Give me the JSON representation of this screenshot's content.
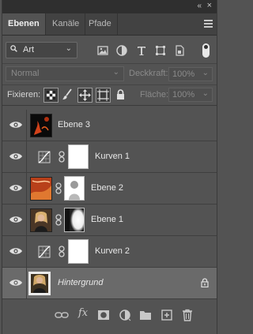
{
  "panel": {
    "tabs": [
      {
        "label": "Ebenen",
        "active": true
      },
      {
        "label": "Kanäle",
        "active": false
      },
      {
        "label": "Pfade",
        "active": false
      }
    ]
  },
  "filter": {
    "kind_value": "Art",
    "icons": [
      "image-filter-icon",
      "adjustment-filter-icon",
      "type-filter-icon",
      "shape-filter-icon",
      "smart-object-filter-icon"
    ]
  },
  "blend": {
    "mode": "Normal",
    "opacity_label": "Deckkraft:",
    "opacity_value": "100%"
  },
  "lock": {
    "label": "Fixieren:",
    "fill_label": "Fläche:",
    "fill_value": "100%"
  },
  "layers": [
    {
      "name": "Ebene 3",
      "type": "pixel",
      "visible": true
    },
    {
      "name": "Kurven 1",
      "type": "curves",
      "visible": true
    },
    {
      "name": "Ebene 2",
      "type": "pixel-mask",
      "visible": true
    },
    {
      "name": "Ebene 1",
      "type": "pixel-mask",
      "visible": true
    },
    {
      "name": "Kurven 2",
      "type": "curves",
      "visible": true
    },
    {
      "name": "Hintergrund",
      "type": "background",
      "visible": true,
      "locked": true,
      "selected": true
    }
  ],
  "bottom_icons": [
    "link-layers-icon",
    "fx-icon",
    "add-mask-icon",
    "adjustment-layer-icon",
    "new-group-icon",
    "new-layer-icon",
    "delete-layer-icon"
  ],
  "colors": {
    "panel_bg": "#535353",
    "selected_row": "#6a6a6a",
    "tab_bar": "#424242"
  }
}
